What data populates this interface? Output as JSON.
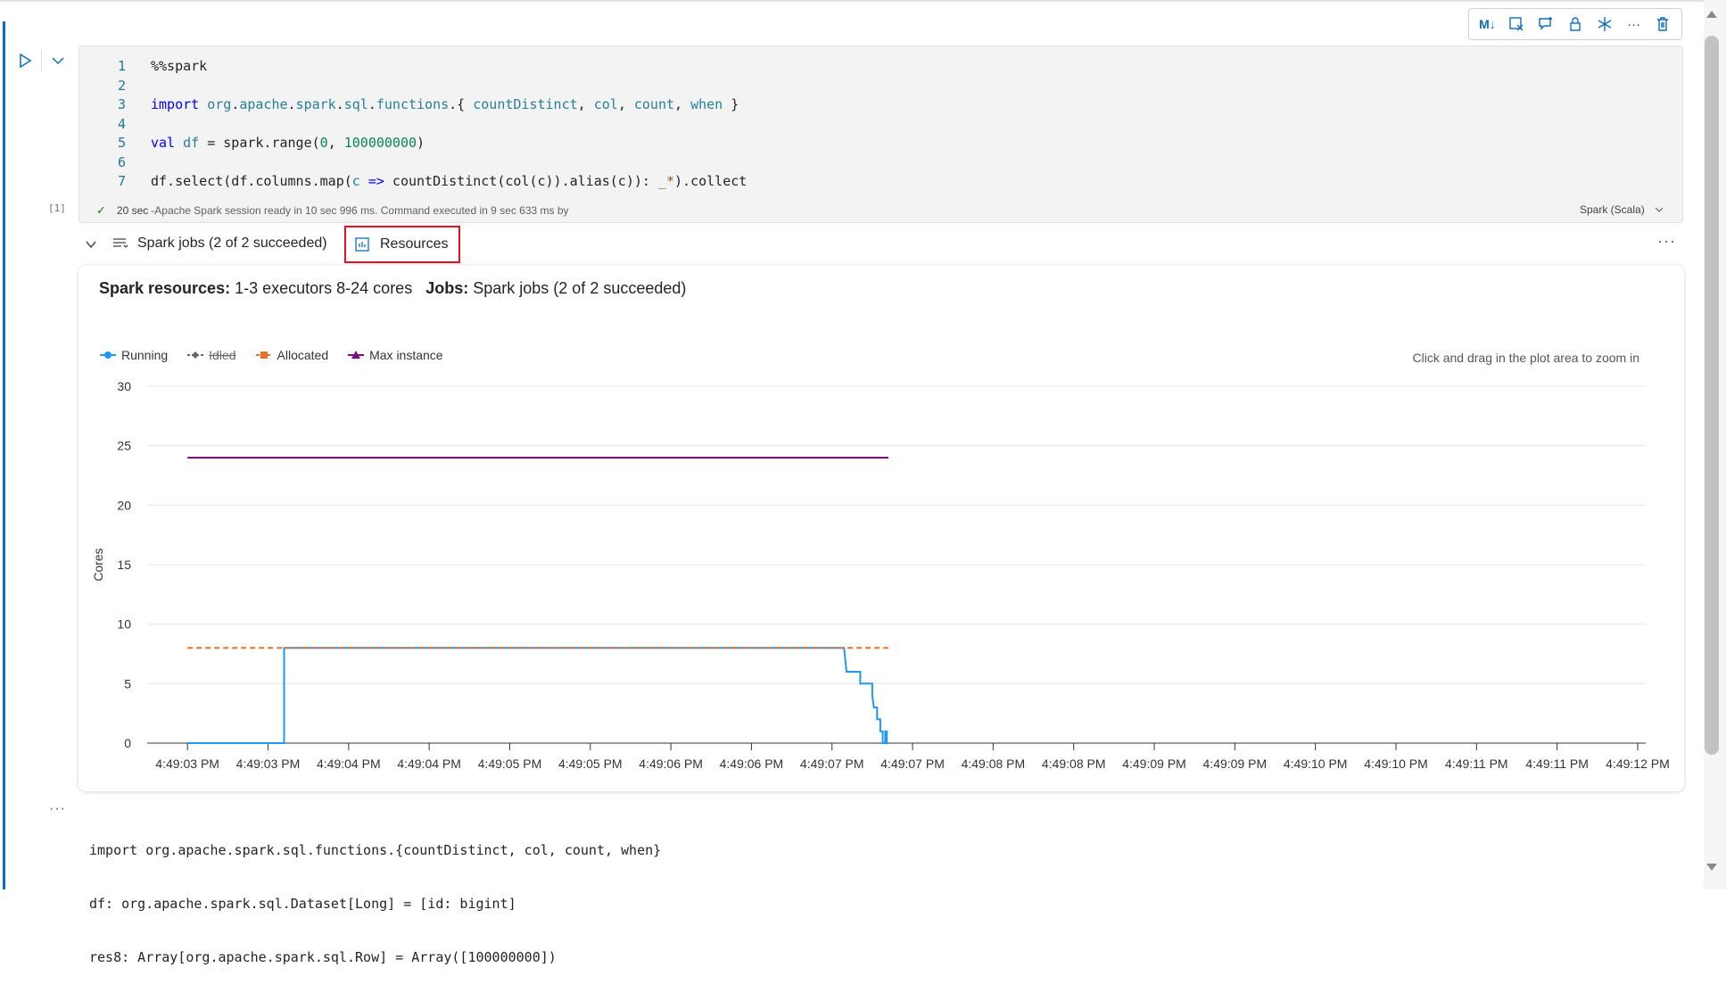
{
  "toolbar": {
    "items": [
      {
        "label": "M↓",
        "icon": "markdown-icon"
      },
      {
        "label": "",
        "icon": "clear-output-icon"
      },
      {
        "label": "",
        "icon": "comment-icon"
      },
      {
        "label": "",
        "icon": "lock-icon"
      },
      {
        "label": "",
        "icon": "freeze-icon"
      },
      {
        "label": "···",
        "icon": "more-icon"
      },
      {
        "label": "",
        "icon": "delete-icon"
      }
    ]
  },
  "cell": {
    "exec_count": "[1]",
    "line_numbers": [
      "1",
      "2",
      "3",
      "4",
      "5",
      "6",
      "7"
    ],
    "status_time": "20 sec",
    "status_text": "-Apache Spark session ready in 10 sec 996 ms. Command executed in 9 sec 633 ms by",
    "language": "Spark (Scala)"
  },
  "tabs": {
    "jobs_label": "Spark jobs (2 of 2 succeeded)",
    "resources_label": "Resources",
    "more": "···"
  },
  "resources": {
    "spark_resources_label": "Spark resources:",
    "spark_resources_value": "1-3 executors 8-24 cores",
    "jobs_label": "Jobs:",
    "jobs_value": "Spark jobs (2 of 2 succeeded)",
    "zoom_hint": "Click and drag in the plot area to zoom in"
  },
  "chart_data": {
    "type": "line",
    "ylabel": "Cores",
    "xlabel": "",
    "ylim": [
      0,
      30
    ],
    "yticks": [
      0,
      5,
      10,
      15,
      20,
      25,
      30
    ],
    "xticks": [
      "4:49:03 PM",
      "4:49:03 PM",
      "4:49:04 PM",
      "4:49:04 PM",
      "4:49:05 PM",
      "4:49:05 PM",
      "4:49:06 PM",
      "4:49:06 PM",
      "4:49:07 PM",
      "4:49:07 PM",
      "4:49:08 PM",
      "4:49:08 PM",
      "4:49:09 PM",
      "4:49:09 PM",
      "4:49:10 PM",
      "4:49:10 PM",
      "4:49:11 PM",
      "4:49:11 PM",
      "4:49:12 PM"
    ],
    "legend_position": "top-left",
    "grid": true,
    "series": [
      {
        "name": "Running",
        "color": "#2196f3",
        "style": "solid",
        "points": [
          [
            0,
            0
          ],
          [
            1.2,
            0
          ],
          [
            1.2,
            8
          ],
          [
            8.15,
            8
          ],
          [
            8.18,
            6
          ],
          [
            8.35,
            6
          ],
          [
            8.35,
            5
          ],
          [
            8.5,
            5
          ],
          [
            8.5,
            4
          ],
          [
            8.52,
            3
          ],
          [
            8.56,
            3
          ],
          [
            8.56,
            2
          ],
          [
            8.6,
            2
          ],
          [
            8.6,
            1
          ],
          [
            8.63,
            1
          ],
          [
            8.63,
            0
          ],
          [
            8.66,
            0
          ],
          [
            8.66,
            1
          ],
          [
            8.68,
            1
          ],
          [
            8.68,
            0
          ],
          [
            8.7,
            0
          ]
        ]
      },
      {
        "name": "Idled",
        "color": "#666666",
        "style": "hidden",
        "points": []
      },
      {
        "name": "Allocated",
        "color": "#e8702a",
        "style": "dashed",
        "points": [
          [
            0,
            8
          ],
          [
            8.7,
            8
          ]
        ]
      },
      {
        "name": "Max instance",
        "color": "#7b0c7e",
        "style": "solid",
        "points": [
          [
            0,
            24
          ],
          [
            8.7,
            24
          ]
        ]
      }
    ]
  },
  "output": {
    "lines": [
      "import org.apache.spark.sql.functions.{countDistinct, col, count, when}",
      "df: org.apache.spark.sql.Dataset[Long] = [id: bigint]",
      "res8: Array[org.apache.spark.sql.Row] = Array([100000000])"
    ],
    "more": "···"
  }
}
